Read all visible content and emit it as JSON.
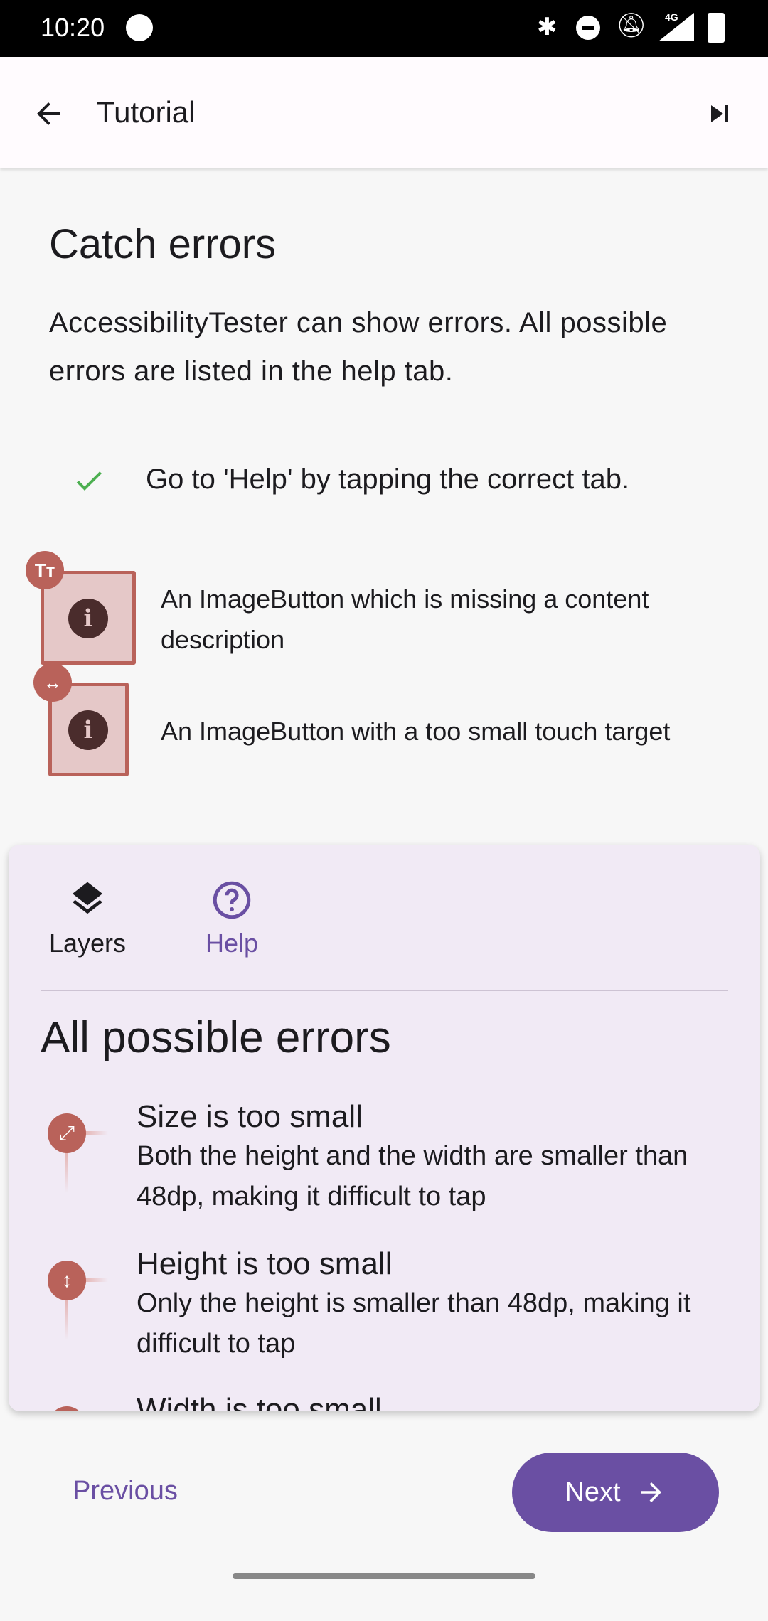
{
  "status_bar": {
    "time": "10:20",
    "icons": [
      "notification-app-icon",
      "bluetooth-icon",
      "do-not-disturb-icon",
      "notifications-off-icon",
      "signal-4g-icon",
      "battery-charging-icon"
    ],
    "network": "4G"
  },
  "app_bar": {
    "title": "Tutorial",
    "back_icon": "arrow-back-icon",
    "skip_icon": "skip-next-icon"
  },
  "content": {
    "heading": "Catch errors",
    "paragraph": "AccessibilityTester can show errors. All possible errors are listed in the help tab.",
    "task": {
      "text": "Go to 'Help' by tapping the correct tab.",
      "done": true,
      "check_color": "#4caf50"
    },
    "examples": [
      {
        "badge": "Tт",
        "text": "An ImageButton which is missing a content description"
      },
      {
        "badge": "↔",
        "text": "An ImageButton with a too small touch target"
      }
    ]
  },
  "help_card": {
    "tabs": [
      {
        "label": "Layers",
        "icon": "layers-icon",
        "selected": false
      },
      {
        "label": "Help",
        "icon": "help-circle-icon",
        "selected": true
      }
    ],
    "title": "All possible errors",
    "errors": [
      {
        "icon": "⤢",
        "title": "Size is too small",
        "desc": "Both the height and the width are smaller than 48dp, making it difficult to tap"
      },
      {
        "icon": "↕",
        "title": "Height is too small",
        "desc": "Only the height is smaller than 48dp, making it difficult to tap"
      },
      {
        "icon": "↔",
        "title": "Width is too small",
        "desc": ""
      }
    ]
  },
  "footer": {
    "previous": "Previous",
    "next": "Next"
  },
  "colors": {
    "accent": "#6a4fa3",
    "error": "#b9625a",
    "card_bg": "#f1eaf5"
  }
}
